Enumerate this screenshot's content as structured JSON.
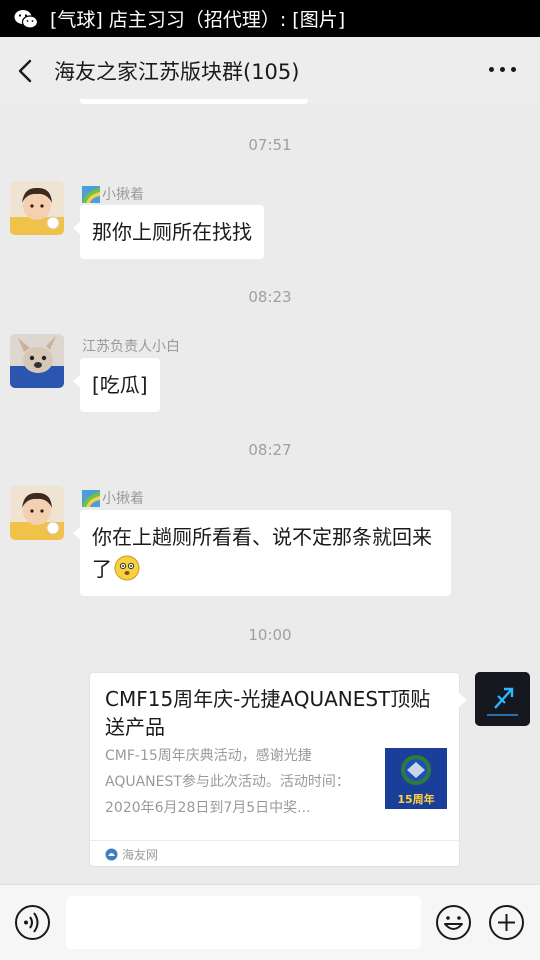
{
  "status_bar": {
    "notification": "[气球] 店主习习（招代理）: [图片]",
    "app_icon": "wechat-icon"
  },
  "header": {
    "title": "海友之家江苏版块群(105)",
    "back_icon": "chevron-left-icon",
    "more_icon": "more-dots-icon"
  },
  "messages": [
    {
      "type": "time",
      "text": "07:51"
    },
    {
      "type": "msg",
      "sender": "小揪着",
      "text": "那你上厕所在找找"
    },
    {
      "type": "time",
      "text": "08:23"
    },
    {
      "type": "msg",
      "sender": "江苏负责人小白",
      "text": "[吃瓜]"
    },
    {
      "type": "time",
      "text": "08:27"
    },
    {
      "type": "msg",
      "sender": "小揪着",
      "text": "你在上趟厕所看看、说不定那条就回来了"
    },
    {
      "type": "time",
      "text": "10:00"
    }
  ],
  "link_card": {
    "title": "CMF15周年庆-光捷AQUANEST顶贴送产品",
    "description": "CMF-15周年庆典活动，感谢光捷AQUANEST参与此次活动。活动时间：2020年6月28日到7月5日中奖...",
    "source": "海友网",
    "thumb_caption": "15周年"
  },
  "input_bar": {
    "value": "",
    "voice_icon": "voice-icon",
    "emoji_icon": "emoji-icon",
    "plus_icon": "plus-icon"
  },
  "colors": {
    "background": "#ebebeb",
    "bubble": "#ffffff",
    "status_bar": "#000000",
    "muted_text": "#a0a0a0"
  }
}
